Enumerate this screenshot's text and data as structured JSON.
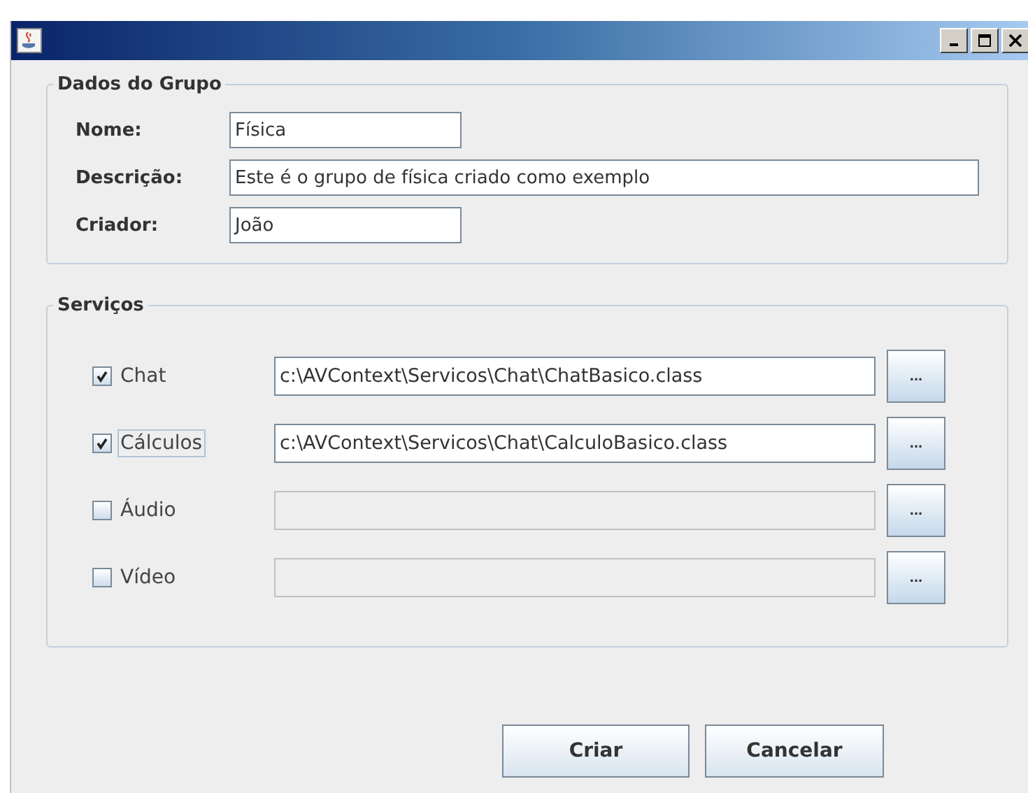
{
  "group": {
    "title": "Dados do Grupo",
    "fields": [
      {
        "label": "Nome:",
        "value": "Física",
        "wide": false
      },
      {
        "label": "Descrição:",
        "value": "Este é o grupo de física criado como exemplo",
        "wide": true
      },
      {
        "label": "Criador:",
        "value": "João",
        "wide": false
      }
    ]
  },
  "services": {
    "title": "Serviços",
    "items": [
      {
        "label": "Chat",
        "checked": true,
        "focused": false,
        "path": "c:\\AVContext\\Servicos\\Chat\\ChatBasico.class",
        "enabled": true,
        "browse": "..."
      },
      {
        "label": "Cálculos",
        "checked": true,
        "focused": true,
        "path": "c:\\AVContext\\Servicos\\Chat\\CalculoBasico.class",
        "enabled": true,
        "browse": "..."
      },
      {
        "label": "Áudio",
        "checked": false,
        "focused": false,
        "enabled": false,
        "browse": "..."
      },
      {
        "label": "Vídeo",
        "checked": false,
        "focused": false,
        "enabled": false,
        "browse": "..."
      }
    ]
  },
  "buttons": [
    "Criar",
    "Cancelar"
  ]
}
